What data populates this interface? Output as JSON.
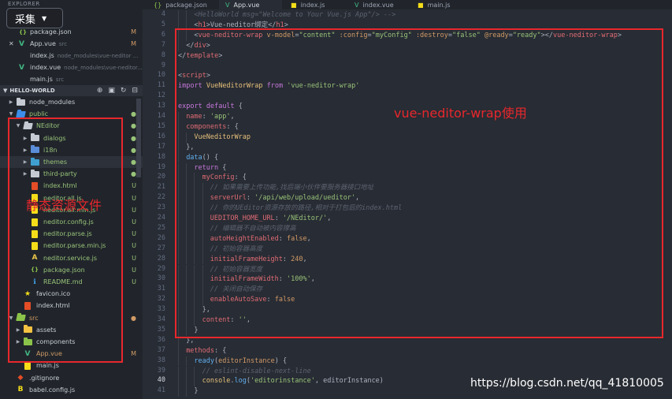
{
  "colors": {
    "editor_bg": "#282c34",
    "sidebar_bg": "#21252b",
    "annotation_red": "#e8272c",
    "folder_default": "#c5cad3",
    "vue_green": "#41b883",
    "modified": "#d19a66",
    "untracked": "#98c379"
  },
  "sidebar": {
    "explorer_title": "EXPLORER",
    "open_editors": [
      {
        "icon": "json-icon",
        "name": "package.json",
        "path": "",
        "status": "M"
      },
      {
        "icon": "vue-icon",
        "name": "App.vue",
        "path": "src",
        "status": "M",
        "close": "✕"
      },
      {
        "icon": "js-icon",
        "name": "index.js",
        "path": "node_modules\\vue-neditor ...",
        "status": ""
      },
      {
        "icon": "vue-icon",
        "name": "index.vue",
        "path": "node_modules\\vue-neditor...",
        "status": ""
      },
      {
        "icon": "js-icon",
        "name": "main.js",
        "path": "src",
        "status": ""
      }
    ],
    "project": {
      "label": "HELLO-WORLD",
      "tools": [
        "new-file-icon",
        "new-folder-icon",
        "refresh-icon",
        "collapse-icon"
      ]
    },
    "tree": [
      {
        "depth": 0,
        "twisty": "▶",
        "icon": "folder-icon",
        "color": "#c5cad3",
        "name": "node_modules",
        "status": "",
        "status_color": ""
      },
      {
        "depth": 0,
        "twisty": "▼",
        "icon": "folder-open-icon",
        "color": "#3b8eea",
        "name": "public",
        "status": "●",
        "status_color": "#98c379",
        "name_color": "#98c379"
      },
      {
        "depth": 1,
        "twisty": "▼",
        "icon": "folder-open-icon",
        "color": "#c5cad3",
        "name": "NEditor",
        "status": "●",
        "status_color": "#98c379",
        "name_color": "#98c379"
      },
      {
        "depth": 2,
        "twisty": "▶",
        "icon": "folder-icon",
        "color": "#c5cad3",
        "name": "dialogs",
        "status": "●",
        "status_color": "#98c379",
        "name_color": "#98c379"
      },
      {
        "depth": 2,
        "twisty": "▶",
        "icon": "folder-icon",
        "color": "#5a8dd8",
        "name": "i18n",
        "status": "●",
        "status_color": "#98c379",
        "name_color": "#98c379"
      },
      {
        "depth": 2,
        "twisty": "▶",
        "icon": "folder-icon",
        "color": "#3f9fd0",
        "name": "themes",
        "status": "●",
        "status_color": "#98c379",
        "name_color": "#98c379"
      },
      {
        "depth": 2,
        "twisty": "▶",
        "icon": "folder-icon",
        "color": "#c5cad3",
        "name": "third-party",
        "status": "●",
        "status_color": "#98c379",
        "name_color": "#98c379"
      },
      {
        "depth": 2,
        "twisty": "",
        "icon": "html-icon",
        "color": "#e44d26",
        "name": "index.html",
        "status": "U",
        "status_color": "#98c379",
        "name_color": "#98c379"
      },
      {
        "depth": 2,
        "twisty": "",
        "icon": "js-icon",
        "color": "#f5de19",
        "name": "neditor.all.js",
        "status": "U",
        "status_color": "#98c379",
        "name_color": "#98c379"
      },
      {
        "depth": 2,
        "twisty": "",
        "icon": "js-icon",
        "color": "#f5de19",
        "name": "neditor.all.min.js",
        "status": "U",
        "status_color": "#98c379",
        "name_color": "#98c379"
      },
      {
        "depth": 2,
        "twisty": "",
        "icon": "js-icon",
        "color": "#f5de19",
        "name": "neditor.config.js",
        "status": "U",
        "status_color": "#98c379",
        "name_color": "#98c379"
      },
      {
        "depth": 2,
        "twisty": "",
        "icon": "js-icon",
        "color": "#f5de19",
        "name": "neditor.parse.js",
        "status": "U",
        "status_color": "#98c379",
        "name_color": "#98c379"
      },
      {
        "depth": 2,
        "twisty": "",
        "icon": "js-icon",
        "color": "#f5de19",
        "name": "neditor.parse.min.js",
        "status": "U",
        "status_color": "#98c379",
        "name_color": "#98c379"
      },
      {
        "depth": 2,
        "twisty": "",
        "icon": "angular-service-icon",
        "color": "#e8c547",
        "name": "neditor.service.js",
        "status": "U",
        "status_color": "#98c379",
        "name_color": "#98c379"
      },
      {
        "depth": 2,
        "twisty": "",
        "icon": "json-icon",
        "color": "#8bc34a",
        "name": "package.json",
        "status": "U",
        "status_color": "#98c379",
        "name_color": "#98c379"
      },
      {
        "depth": 2,
        "twisty": "",
        "icon": "info-icon",
        "color": "#42a5f5",
        "name": "README.md",
        "status": "U",
        "status_color": "#98c379",
        "name_color": "#98c379"
      },
      {
        "depth": 1,
        "twisty": "",
        "icon": "favicon-icon",
        "color": "#f5de19",
        "name": "favicon.ico",
        "status": "",
        "status_color": "",
        "name_color": "#c8ccd4"
      },
      {
        "depth": 1,
        "twisty": "",
        "icon": "html-icon",
        "color": "#e44d26",
        "name": "index.html",
        "status": "",
        "status_color": "",
        "name_color": "#c8ccd4"
      },
      {
        "depth": 0,
        "twisty": "▼",
        "icon": "folder-open-icon",
        "color": "#8bc34a",
        "name": "src",
        "status": "●",
        "status_color": "#d19a66",
        "name_color": "#d19a66"
      },
      {
        "depth": 1,
        "twisty": "▶",
        "icon": "folder-icon",
        "color": "#f5c242",
        "name": "assets",
        "status": "",
        "status_color": "",
        "name_color": "#c8ccd4"
      },
      {
        "depth": 1,
        "twisty": "▶",
        "icon": "folder-icon",
        "color": "#8bc34a",
        "name": "components",
        "status": "",
        "status_color": "",
        "name_color": "#c8ccd4"
      },
      {
        "depth": 1,
        "twisty": "",
        "icon": "vue-icon",
        "color": "#41b883",
        "name": "App.vue",
        "status": "M",
        "status_color": "#d19a66",
        "name_color": "#d19a66"
      },
      {
        "depth": 1,
        "twisty": "",
        "icon": "js-icon",
        "color": "#f5de19",
        "name": "main.js",
        "status": "",
        "status_color": "",
        "name_color": "#c8ccd4"
      },
      {
        "depth": 0,
        "twisty": "",
        "icon": "git-icon",
        "color": "#e44d26",
        "name": ".gitignore",
        "status": "",
        "status_color": "",
        "name_color": "#c8ccd4"
      },
      {
        "depth": 0,
        "twisty": "",
        "icon": "babel-icon",
        "color": "#f5de19",
        "name": "babel.config.js",
        "status": "",
        "status_color": "",
        "name_color": "#c8ccd4"
      }
    ]
  },
  "overlay": {
    "label": "采集",
    "caret": "▼"
  },
  "tabs": [
    {
      "icon": "json-icon",
      "label": "package.json",
      "active": false
    },
    {
      "icon": "vue-icon",
      "label": "App.vue",
      "active": true
    },
    {
      "icon": "js-icon",
      "label": "index.js",
      "active": false
    },
    {
      "icon": "vue-icon",
      "label": "index.vue",
      "active": false
    },
    {
      "icon": "js-icon",
      "label": "main.js",
      "active": false
    }
  ],
  "editor": {
    "active_line": 40,
    "lines": [
      {
        "no": 4,
        "indent": 2,
        "tokens": [
          [
            "t-com",
            "<HelloWorld msg=\"Welcome to Your Vue.js App\"/> -->"
          ]
        ]
      },
      {
        "no": 5,
        "indent": 2,
        "tokens": [
          [
            "t-pun",
            "<"
          ],
          [
            "t-tag",
            "h1"
          ],
          [
            "t-pun",
            ">"
          ],
          [
            "",
            "Vue-neditor绑定"
          ],
          [
            "t-pun",
            "</"
          ],
          [
            "t-tag",
            "h1"
          ],
          [
            "t-pun",
            ">"
          ]
        ]
      },
      {
        "no": 6,
        "indent": 2,
        "tokens": [
          [
            "t-pun",
            "<"
          ],
          [
            "t-tag",
            "vue-neditor-wrap"
          ],
          [
            "",
            " "
          ],
          [
            "t-attr",
            "v-model"
          ],
          [
            "",
            "="
          ],
          [
            "t-str",
            "\"content\""
          ],
          [
            "",
            " "
          ],
          [
            "t-attr",
            ":config"
          ],
          [
            "",
            "="
          ],
          [
            "t-str",
            "\"myConfig\""
          ],
          [
            "",
            " "
          ],
          [
            "t-attr",
            ":destroy"
          ],
          [
            "",
            "="
          ],
          [
            "t-str",
            "\"false\""
          ],
          [
            "",
            " "
          ],
          [
            "t-attr",
            "@ready"
          ],
          [
            "",
            "="
          ],
          [
            "t-str",
            "\"ready\""
          ],
          [
            "t-pun",
            "></"
          ],
          [
            "t-tag",
            "vue-neditor-wrap"
          ],
          [
            "t-pun",
            ">"
          ]
        ]
      },
      {
        "no": 7,
        "indent": 1,
        "tokens": [
          [
            "t-pun",
            "</"
          ],
          [
            "t-tag",
            "div"
          ],
          [
            "t-pun",
            ">"
          ]
        ]
      },
      {
        "no": 8,
        "indent": 0,
        "tokens": [
          [
            "t-pun",
            "</"
          ],
          [
            "t-tag",
            "template"
          ],
          [
            "t-pun",
            ">"
          ]
        ]
      },
      {
        "no": 9,
        "indent": 0,
        "tokens": []
      },
      {
        "no": 10,
        "indent": 0,
        "tokens": [
          [
            "t-pun",
            "<"
          ],
          [
            "t-tag",
            "script"
          ],
          [
            "t-pun",
            ">"
          ]
        ]
      },
      {
        "no": 11,
        "indent": 0,
        "tokens": [
          [
            "t-kw",
            "import"
          ],
          [
            "",
            " "
          ],
          [
            "t-cls",
            "VueNeditorWrap"
          ],
          [
            "",
            " "
          ],
          [
            "t-kw",
            "from"
          ],
          [
            "",
            " "
          ],
          [
            "t-str",
            "'vue-neditor-wrap'"
          ]
        ]
      },
      {
        "no": 12,
        "indent": 0,
        "tokens": []
      },
      {
        "no": 13,
        "indent": 0,
        "tokens": [
          [
            "t-kw",
            "export"
          ],
          [
            "",
            " "
          ],
          [
            "t-kw",
            "default"
          ],
          [
            "",
            " {"
          ]
        ]
      },
      {
        "no": 14,
        "indent": 1,
        "tokens": [
          [
            "t-prop",
            "name"
          ],
          [
            "",
            ": "
          ],
          [
            "t-str",
            "'app'"
          ],
          [
            "",
            ","
          ]
        ]
      },
      {
        "no": 15,
        "indent": 1,
        "tokens": [
          [
            "t-prop",
            "components"
          ],
          [
            "",
            ": {"
          ]
        ]
      },
      {
        "no": 16,
        "indent": 2,
        "tokens": [
          [
            "t-cls",
            "VueNeditorWrap"
          ]
        ]
      },
      {
        "no": 17,
        "indent": 1,
        "tokens": [
          [
            "",
            "},"
          ]
        ]
      },
      {
        "no": 18,
        "indent": 1,
        "tokens": [
          [
            "t-fn",
            "data"
          ],
          [
            "",
            "() {"
          ]
        ]
      },
      {
        "no": 19,
        "indent": 2,
        "tokens": [
          [
            "t-kw",
            "return"
          ],
          [
            "",
            " {"
          ]
        ]
      },
      {
        "no": 20,
        "indent": 3,
        "tokens": [
          [
            "t-prop",
            "myConfig"
          ],
          [
            "",
            ": {"
          ]
        ]
      },
      {
        "no": 21,
        "indent": 4,
        "tokens": [
          [
            "t-com",
            "// 如果需要上传功能,找后端小伙伴要服务器接口地址"
          ]
        ]
      },
      {
        "no": 22,
        "indent": 4,
        "tokens": [
          [
            "t-prop",
            "serverUrl"
          ],
          [
            "",
            ": "
          ],
          [
            "t-str",
            "'/api/web/upload/ueditor'"
          ],
          [
            "",
            ","
          ]
        ]
      },
      {
        "no": 23,
        "indent": 4,
        "tokens": [
          [
            "t-com",
            "// 你的UEditor资源存放的路径,相对于打包后的index.html"
          ]
        ]
      },
      {
        "no": 24,
        "indent": 4,
        "tokens": [
          [
            "t-prop",
            "UEDITOR_HOME_URL"
          ],
          [
            "",
            ": "
          ],
          [
            "t-str",
            "'/NEditor/'"
          ],
          [
            "",
            ","
          ]
        ]
      },
      {
        "no": 25,
        "indent": 4,
        "tokens": [
          [
            "t-com",
            "// 编辑器不自动被内容撑高"
          ]
        ]
      },
      {
        "no": 26,
        "indent": 4,
        "tokens": [
          [
            "t-prop",
            "autoHeightEnabled"
          ],
          [
            "",
            ": "
          ],
          [
            "t-num",
            "false"
          ],
          [
            "",
            ","
          ]
        ]
      },
      {
        "no": 27,
        "indent": 4,
        "tokens": [
          [
            "t-com",
            "// 初始容器高度"
          ]
        ]
      },
      {
        "no": 28,
        "indent": 4,
        "tokens": [
          [
            "t-prop",
            "initialFrameHeight"
          ],
          [
            "",
            ": "
          ],
          [
            "t-num",
            "240"
          ],
          [
            "",
            ","
          ]
        ]
      },
      {
        "no": 29,
        "indent": 4,
        "tokens": [
          [
            "t-com",
            "// 初始容器宽度"
          ]
        ]
      },
      {
        "no": 30,
        "indent": 4,
        "tokens": [
          [
            "t-prop",
            "initialFrameWidth"
          ],
          [
            "",
            ": "
          ],
          [
            "t-str",
            "'100%'"
          ],
          [
            "",
            ","
          ]
        ]
      },
      {
        "no": 31,
        "indent": 4,
        "tokens": [
          [
            "t-com",
            "// 关闭自动保存"
          ]
        ]
      },
      {
        "no": 32,
        "indent": 4,
        "tokens": [
          [
            "t-prop",
            "enableAutoSave"
          ],
          [
            "",
            ": "
          ],
          [
            "t-num",
            "false"
          ]
        ]
      },
      {
        "no": 33,
        "indent": 3,
        "tokens": [
          [
            "",
            "},"
          ]
        ]
      },
      {
        "no": 34,
        "indent": 3,
        "tokens": [
          [
            "t-prop",
            "content"
          ],
          [
            "",
            ": "
          ],
          [
            "t-str",
            "''"
          ],
          [
            "",
            ","
          ]
        ]
      },
      {
        "no": 35,
        "indent": 2,
        "tokens": [
          [
            "",
            "}"
          ]
        ]
      },
      {
        "no": 36,
        "indent": 1,
        "tokens": [
          [
            "",
            "},"
          ]
        ]
      },
      {
        "no": 37,
        "indent": 1,
        "tokens": [
          [
            "t-prop",
            "methods"
          ],
          [
            "",
            ": {"
          ]
        ]
      },
      {
        "no": 38,
        "indent": 2,
        "tokens": [
          [
            "t-fn",
            "ready"
          ],
          [
            "",
            "("
          ],
          [
            "t-attr",
            "editorInstance"
          ],
          [
            "",
            ") {"
          ]
        ]
      },
      {
        "no": 39,
        "indent": 3,
        "tokens": [
          [
            "t-com",
            "// eslint-disable-next-line"
          ]
        ]
      },
      {
        "no": 40,
        "indent": 3,
        "tokens": [
          [
            "t-cls",
            "console"
          ],
          [
            "",
            "."
          ],
          [
            "t-fn",
            "log"
          ],
          [
            "",
            "("
          ],
          [
            "t-str",
            "'editorinstance'"
          ],
          [
            "",
            ", editorInstance)"
          ]
        ]
      },
      {
        "no": 41,
        "indent": 2,
        "tokens": [
          [
            "",
            "}"
          ]
        ]
      }
    ]
  },
  "annotations": {
    "code_label": "vue-neditor-wrap使用",
    "sidebar_label": "静态资源文件"
  },
  "watermark": "https://blog.csdn.net/qq_41810005"
}
